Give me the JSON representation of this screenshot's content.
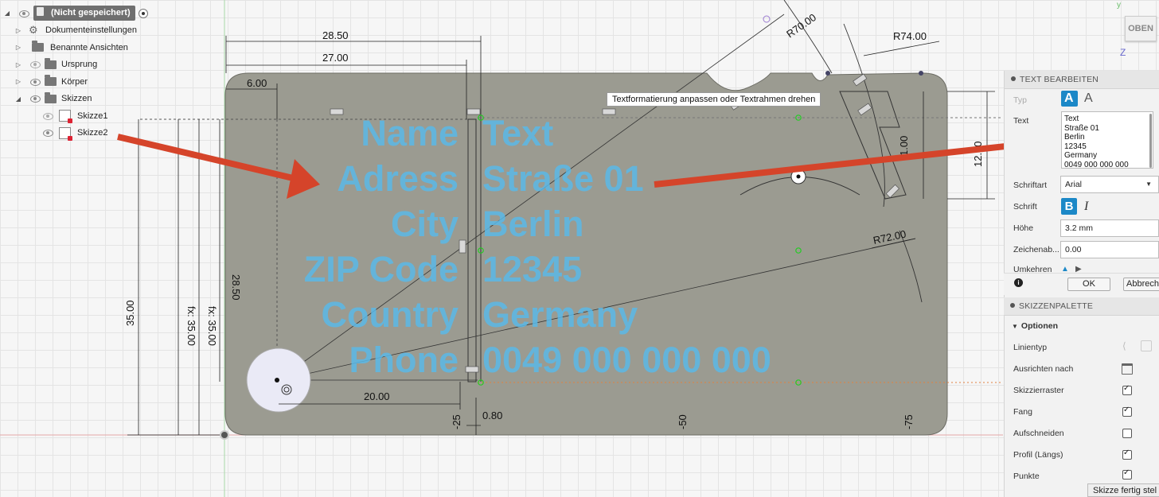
{
  "browser": {
    "document_title": "(Nicht gespeichert)",
    "items": [
      {
        "label": "Dokumenteinstellungen"
      },
      {
        "label": "Benannte Ansichten"
      },
      {
        "label": "Ursprung"
      },
      {
        "label": "Körper"
      },
      {
        "label": "Skizzen"
      },
      {
        "label": "Skizze1"
      },
      {
        "label": "Skizze2"
      }
    ]
  },
  "canvas": {
    "tooltip": "Textformatierung anpassen oder Textrahmen drehen",
    "dimensions": {
      "d1": "28.50",
      "d2": "27.00",
      "d3": "6.00",
      "d4": "R70.00",
      "d5": "R74.00",
      "d6": "R72.00",
      "d7": "20.00",
      "d8": "0.80",
      "d9": "28.50",
      "d10": "35.00",
      "d11": "fx: 35.00",
      "d12": "fx: 35.00",
      "d13": "12.00",
      "d14": "1.00",
      "d15": "-25",
      "d16": "-50",
      "d17": "-75"
    },
    "ghost_text": {
      "labels": [
        "Name",
        "Adress",
        "City",
        "ZIP Code",
        "Country",
        "Phone"
      ],
      "values": [
        "Text",
        "Straße 01",
        "Berlin",
        "12345",
        "Germany",
        "0049 000 000 000"
      ]
    }
  },
  "viewcube": {
    "face": "OBEN",
    "axis_y": "y",
    "axis_z": "Z"
  },
  "text_panel": {
    "title": "TEXT BEARBEITEN",
    "type_label": "Typ",
    "text_label": "Text",
    "text_lines": [
      "Text",
      "Straße 01",
      "Berlin",
      "12345",
      "Germany",
      "0049 000 000 000"
    ],
    "font_label": "Schriftart",
    "font_value": "Arial",
    "style_label": "Schrift",
    "bold_glyph": "B",
    "italic_glyph": "I",
    "height_label": "Höhe",
    "height_value": "3.2 mm",
    "spacing_label": "Zeichenab...",
    "spacing_value": "0.00",
    "flip_label": "Umkehren",
    "ok_label": "OK",
    "cancel_label": "Abbrech"
  },
  "palette": {
    "title": "SKIZZENPALETTE",
    "options_label": "Optionen",
    "items": [
      {
        "label": "Linientyp"
      },
      {
        "label": "Ausrichten nach"
      },
      {
        "label": "Skizzierraster",
        "checked": true
      },
      {
        "label": "Fang",
        "checked": true
      },
      {
        "label": "Aufschneiden",
        "checked": false
      },
      {
        "label": "Profil (Längs)",
        "checked": true
      },
      {
        "label": "Punkte",
        "checked": true
      }
    ],
    "finish_label": "Skizze fertig stel"
  },
  "colors": {
    "plate": "#9b9b91",
    "ghost_text": "#5ab9e6",
    "arrow": "#d5442a",
    "accent": "#1c88c7"
  }
}
